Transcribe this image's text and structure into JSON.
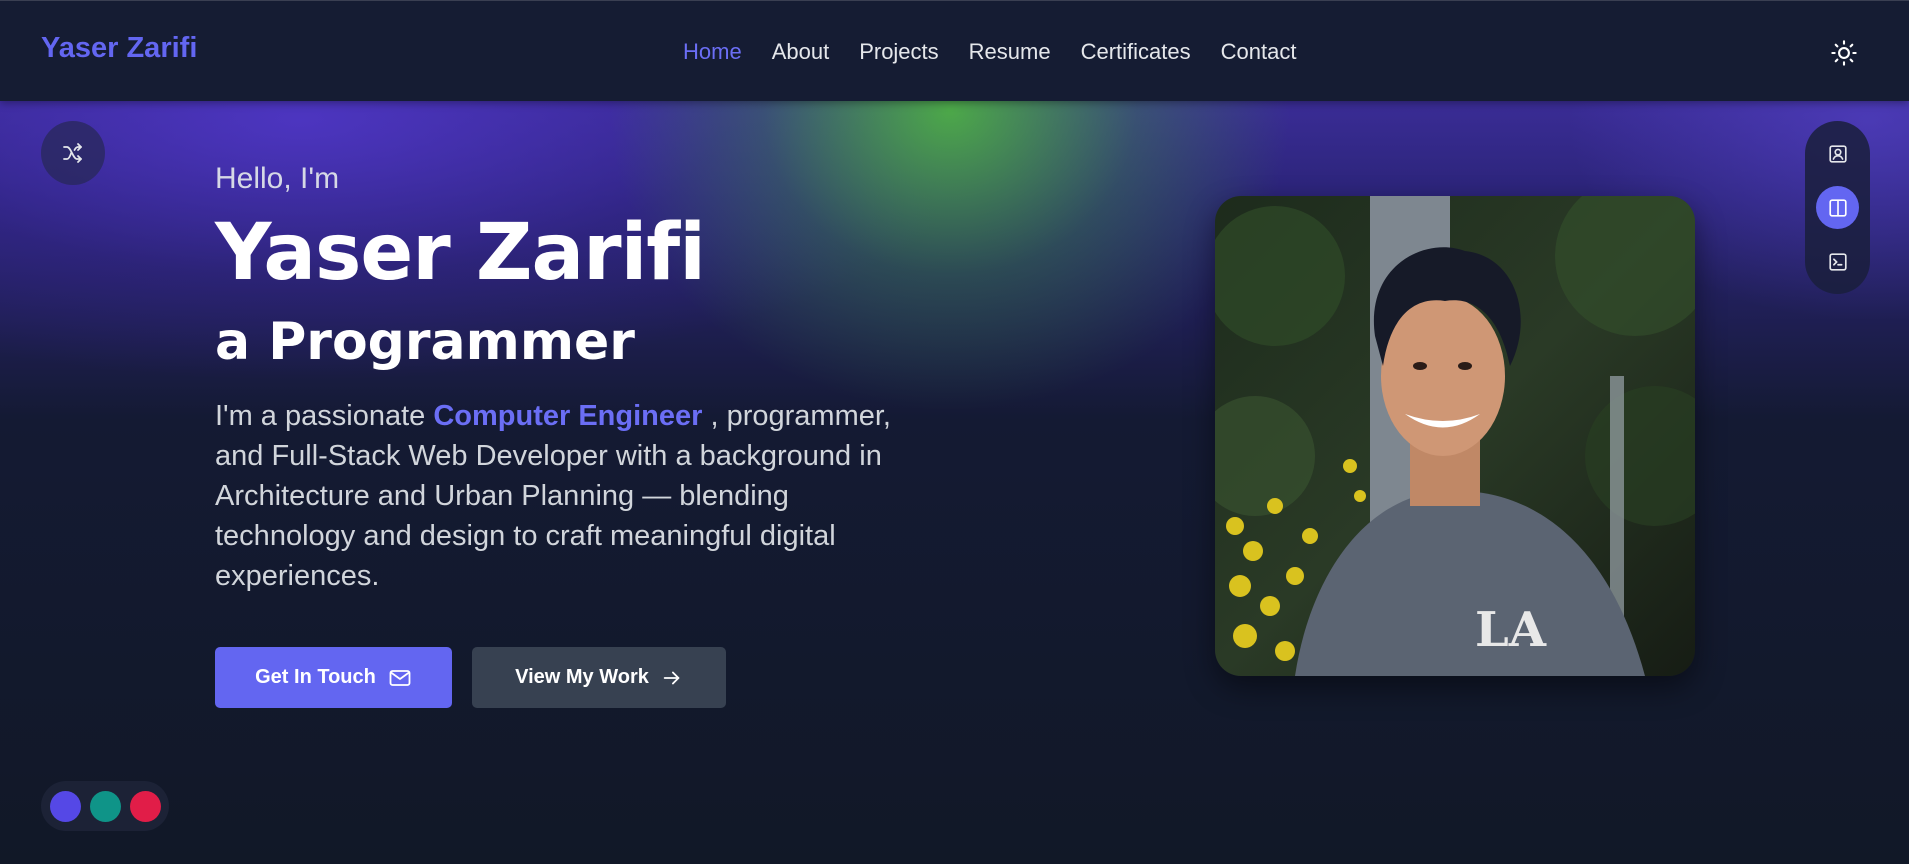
{
  "brand": "Yaser Zarifi",
  "nav": {
    "items": [
      {
        "label": "Home",
        "active": true
      },
      {
        "label": "About",
        "active": false
      },
      {
        "label": "Projects",
        "active": false
      },
      {
        "label": "Resume",
        "active": false
      },
      {
        "label": "Certificates",
        "active": false
      },
      {
        "label": "Contact",
        "active": false
      }
    ],
    "theme_toggle_icon": "sun-icon"
  },
  "hero": {
    "greeting": "Hello, I'm",
    "name": "Yaser Zarifi",
    "role": "a Programmer",
    "description_prefix": "I'm a passionate ",
    "description_highlight": "Computer Engineer",
    "description_suffix": " , programmer, and Full-Stack Web Developer with a background in Architecture and Urban Planning — blending technology and design to craft meaningful digital experiences.",
    "primary_button": "Get In Touch",
    "secondary_button": "View My Work"
  },
  "side_tools": {
    "icons": [
      "contact-card-icon",
      "split-layout-icon",
      "terminal-icon"
    ],
    "active_index": 1
  },
  "floating": {
    "shuffle_icon": "shuffle-icon"
  },
  "colors": {
    "accent": "#6366f1",
    "swatches": [
      "#5548e6",
      "#0f9488",
      "#e11d48"
    ]
  }
}
